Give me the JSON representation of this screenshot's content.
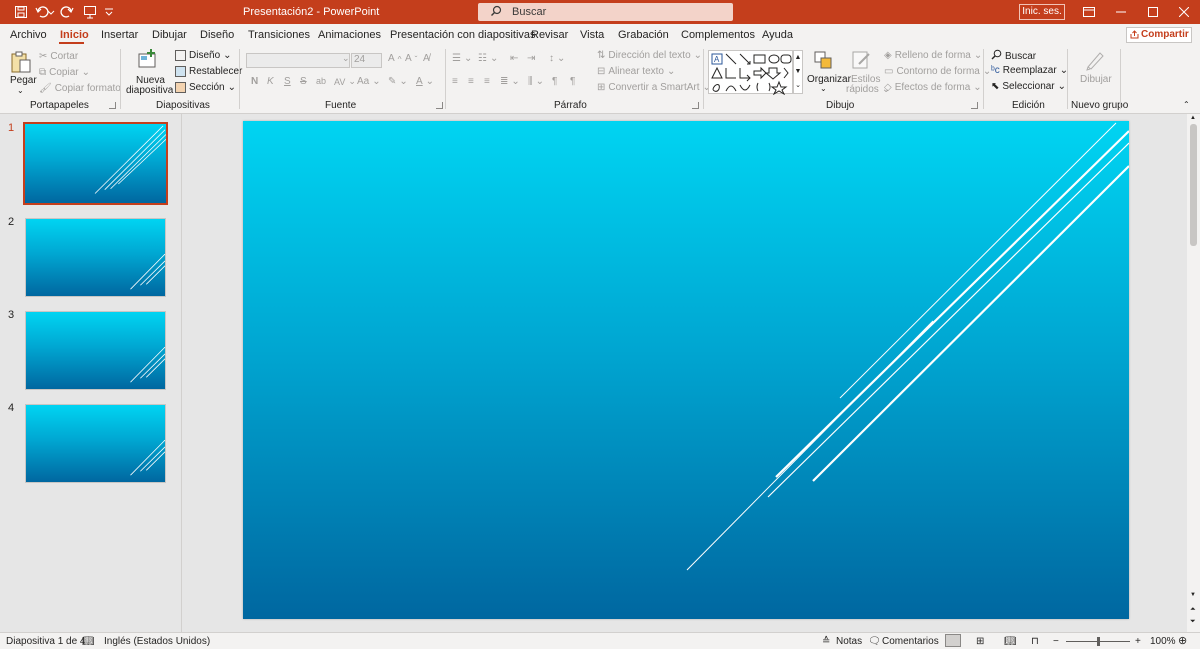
{
  "titlebar": {
    "doc_title": "Presentación2  -  PowerPoint",
    "search_placeholder": "Buscar",
    "signin_label": "Inic. ses.",
    "accent": "#c43e1c"
  },
  "tabs": {
    "items": [
      "Archivo",
      "Inicio",
      "Insertar",
      "Dibujar",
      "Diseño",
      "Transiciones",
      "Animaciones",
      "Presentación con diapositivas",
      "Revisar",
      "Vista",
      "Grabación",
      "Complementos",
      "Ayuda"
    ],
    "active": "Inicio",
    "share_label": "Compartir"
  },
  "ribbon": {
    "portapapeles": {
      "label": "Portapapeles",
      "paste": "Pegar",
      "cut": "Cortar",
      "copy": "Copiar",
      "format_painter": "Copiar formato"
    },
    "diapositivas": {
      "label": "Diapositivas",
      "new_slide_1": "Nueva",
      "new_slide_2": "diapositiva",
      "layout": "Diseño",
      "reset": "Restablecer",
      "section": "Sección"
    },
    "fuente": {
      "label": "Fuente",
      "font_size": "24",
      "bold": "N",
      "italic": "K",
      "underline": "S",
      "strike": "S",
      "spacing": "AV",
      "case": "Aa"
    },
    "parrafo": {
      "label": "Párrafo",
      "direction": "Dirección del texto",
      "align": "Alinear texto",
      "smartart": "Convertir a SmartArt"
    },
    "dibujo": {
      "label": "Dibujo",
      "arrange": "Organizar",
      "styles_1": "Estilos",
      "styles_2": "rápidos",
      "fill": "Relleno de forma",
      "outline": "Contorno de forma",
      "effects": "Efectos de forma"
    },
    "edicion": {
      "label": "Edición",
      "find": "Buscar",
      "replace": "Reemplazar",
      "select": "Seleccionar"
    },
    "nuevo_grupo": {
      "label": "Nuevo grupo",
      "draw": "Dibujar"
    }
  },
  "slides": {
    "numbers": [
      "1",
      "2",
      "3",
      "4"
    ],
    "selected": 1
  },
  "statusbar": {
    "slide_info": "Diapositiva 1 de 4",
    "language": "Inglés (Estados Unidos)",
    "notes": "Notas",
    "comments": "Comentarios",
    "zoom_text": "100%",
    "zoom_level": 1.0
  },
  "icons": [
    "save-icon",
    "undo-icon",
    "redo-icon",
    "present-icon",
    "customize-qa-icon",
    "search-icon",
    "minimize-icon",
    "maximize-icon",
    "close-icon",
    "share-icon",
    "paste-icon",
    "cut-icon",
    "copy-icon",
    "format-painter-icon",
    "new-slide-icon",
    "arrange-icon",
    "quick-styles-icon",
    "find-icon",
    "replace-icon",
    "select-icon",
    "draw-icon",
    "notes-icon",
    "comments-icon",
    "normal-view-icon",
    "slide-sorter-icon",
    "reading-view-icon",
    "slideshow-icon",
    "fit-icon"
  ],
  "colors": {
    "slide_top": "#00d4f2",
    "slide_bottom": "#0067a0",
    "ribbon_bg": "#f3f2f1"
  }
}
